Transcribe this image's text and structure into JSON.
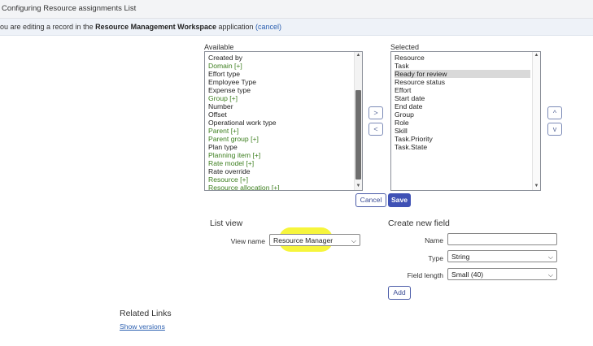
{
  "header": {
    "title": "Configuring Resource assignments List"
  },
  "editing_bar": {
    "prefix": "ou are editing a record in the ",
    "app_name": "Resource Management Workspace",
    "suffix": " application ",
    "cancel_link": "(cancel)"
  },
  "available": {
    "label": "Available",
    "items": [
      {
        "text": "Created by",
        "green": false
      },
      {
        "text": "Domain [+]",
        "green": true
      },
      {
        "text": "Effort type",
        "green": false
      },
      {
        "text": "Employee Type",
        "green": false
      },
      {
        "text": "Expense type",
        "green": false
      },
      {
        "text": "Group [+]",
        "green": true
      },
      {
        "text": "Number",
        "green": false
      },
      {
        "text": "Offset",
        "green": false
      },
      {
        "text": "Operational work type",
        "green": false
      },
      {
        "text": "Parent [+]",
        "green": true
      },
      {
        "text": "Parent group [+]",
        "green": true
      },
      {
        "text": "Plan type",
        "green": false
      },
      {
        "text": "Planning item [+]",
        "green": true
      },
      {
        "text": "Rate model [+]",
        "green": true
      },
      {
        "text": "Rate override",
        "green": false
      },
      {
        "text": "Resource [+]",
        "green": true
      },
      {
        "text": "Resource allocation [+]",
        "green": true
      }
    ]
  },
  "selected": {
    "label": "Selected",
    "items": [
      "Resource",
      "Task",
      "Ready for review",
      "Resource status",
      "Effort",
      "Start date",
      "End date",
      "Group",
      "Role",
      "Skill",
      "Task.Priority",
      "Task.State"
    ],
    "highlighted_index": 2
  },
  "move_buttons": {
    "add": ">",
    "remove": "<",
    "up": "^",
    "down": "v"
  },
  "buttons": {
    "cancel": "Cancel",
    "save": "Save",
    "add": "Add"
  },
  "list_view": {
    "title": "List view",
    "view_name_label": "View name",
    "view_name_value": "Resource Manager"
  },
  "create_field": {
    "title": "Create new field",
    "name_label": "Name",
    "name_value": "",
    "type_label": "Type",
    "type_value": "String",
    "length_label": "Field length",
    "length_value": "Small (40)"
  },
  "related_links": {
    "title": "Related Links",
    "show_versions": "Show versions"
  },
  "colors": {
    "highlight": "#f6f53c",
    "primary": "#3f51b5",
    "green_item": "#3d7f1f"
  }
}
